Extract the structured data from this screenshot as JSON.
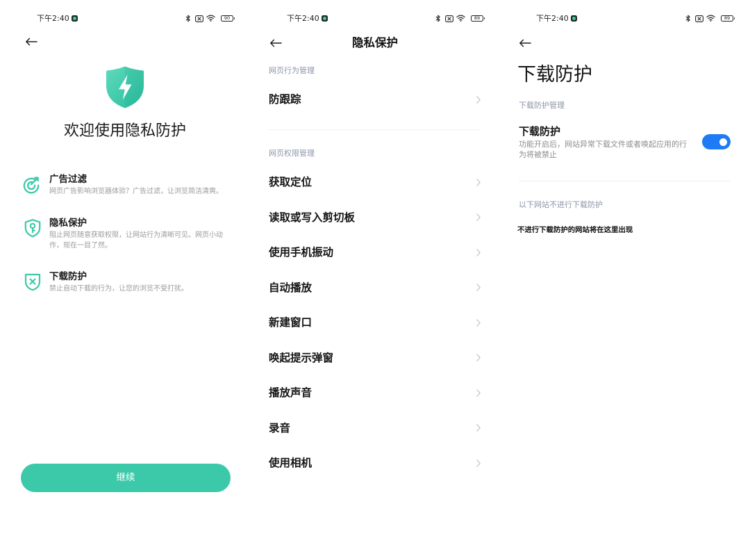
{
  "colors": {
    "accent": "#3cc9a9",
    "toggle_on": "#1d7cf5",
    "section_header": "#8b95a8",
    "description": "#9b9b9b"
  },
  "icons": {
    "status_bar": [
      "app-notification-icon",
      "bluetooth-icon",
      "no-sim-icon",
      "wifi-icon",
      "battery-icon"
    ],
    "back": "back-arrow-icon",
    "chevron": "chevron-right-icon",
    "logo": "shield-lightning-icon"
  },
  "welcome": {
    "status_bar": {
      "time": "下午2:40",
      "battery": "90"
    },
    "title": "欢迎使用隐私防护",
    "features": [
      {
        "icon": "ad-filter-icon",
        "title": "广告过滤",
        "desc": "网页广告影响浏览器体验？广告过滤，让浏览简洁清爽。"
      },
      {
        "icon": "shield-key-icon",
        "title": "隐私保护",
        "desc": "阻止网页随意获取权限，让网站行为清晰可见。网页小动作，现在一目了然。"
      },
      {
        "icon": "shield-x-icon",
        "title": "下载防护",
        "desc": "禁止自动下载的行为，让您的浏览不受打扰。"
      }
    ],
    "continue_label": "继续"
  },
  "privacy": {
    "status_bar": {
      "time": "下午2:40",
      "battery": "89"
    },
    "title": "隐私保护",
    "sections": [
      {
        "header": "网页行为管理",
        "items": [
          "防跟踪"
        ]
      },
      {
        "header": "网页权限管理",
        "items": [
          "获取定位",
          "读取或写入剪切板",
          "使用手机振动",
          "自动播放",
          "新建窗口",
          "唤起提示弹窗",
          "播放声音",
          "录音",
          "使用相机"
        ]
      }
    ]
  },
  "download": {
    "status_bar": {
      "time": "下午2:40",
      "battery": "89"
    },
    "title": "下载防护",
    "section_header": "下载防护管理",
    "setting": {
      "title": "下载防护",
      "desc": "功能开启后，网站异常下载文件或者唤起应用的行为将被禁止",
      "enabled": true
    },
    "exceptions_header": "以下网站不进行下载防护",
    "empty_text": "不进行下载防护的网站将在这里出现"
  }
}
